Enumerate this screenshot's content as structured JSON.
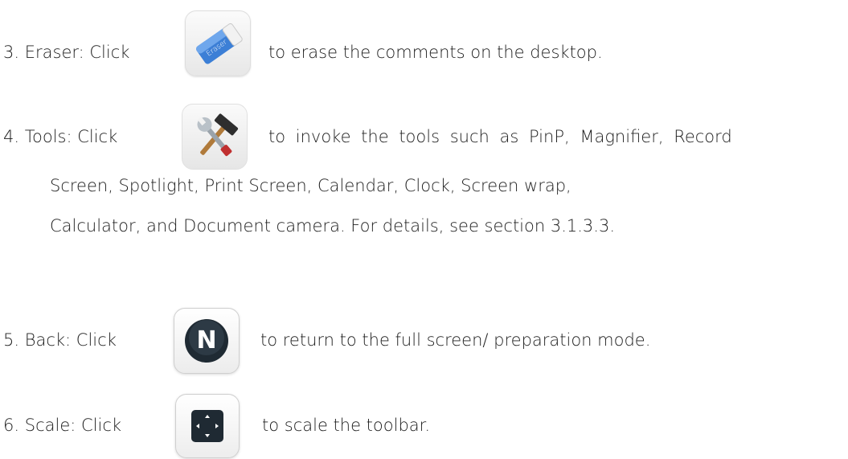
{
  "items": [
    {
      "number": "3.",
      "label": "Eraser: Click",
      "text": "to erase the comments on the desktop.",
      "icon": "eraser-icon"
    },
    {
      "number": "4.",
      "label": "Tools: Click",
      "text": "to invoke the tools such as PinP, Magnifier, Record",
      "icon": "tools-icon",
      "continuation": [
        "Screen, Spotlight, Print Screen, Calendar, Clock, Screen wrap,",
        "Calculator, and Document camera. For details, see section 3.1.3.3."
      ]
    },
    {
      "number": "5.",
      "label": "Back: Click",
      "text": "to return to the full screen/ preparation mode.",
      "icon": "back-icon",
      "icon_letter": "N"
    },
    {
      "number": "6.",
      "label": "Scale: Click",
      "text": "to scale the toolbar.",
      "icon": "scale-icon"
    }
  ],
  "eraser_icon_label": "Eraser"
}
